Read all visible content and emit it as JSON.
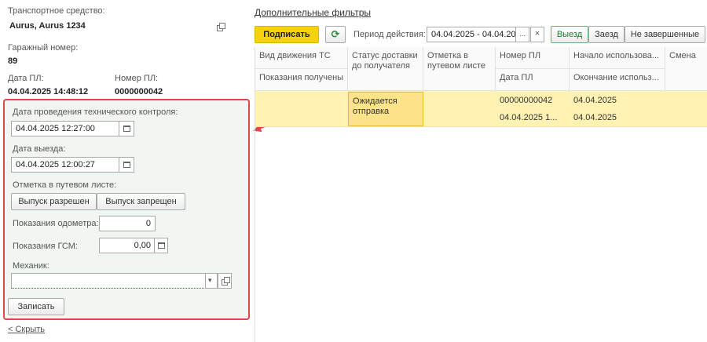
{
  "left": {
    "vehicle_label": "Транспортное средство:",
    "vehicle_value": "Aurus, Aurus 1234",
    "garage_label": "Гаражный номер:",
    "garage_value": "89",
    "date_pl_label": "Дата ПЛ:",
    "date_pl_value": "04.04.2025 14:48:12",
    "number_pl_label": "Номер ПЛ:",
    "number_pl_value": "0000000042"
  },
  "panel": {
    "tech_control_label": "Дата проведения технического контроля:",
    "tech_control_value": "04.04.2025 12:27:00",
    "departure_label": "Дата выезда:",
    "departure_value": "04.04.2025 12:00:27",
    "waybill_mark_label": "Отметка в путевом листе:",
    "allow_button": "Выпуск разрешен",
    "deny_button": "Выпуск запрещен",
    "odometer_label": "Показания одометра:",
    "odometer_value": "0",
    "fuel_label": "Показания ГСМ:",
    "fuel_value": "0,00",
    "mechanic_label": "Механик:",
    "mechanic_value": "",
    "save_button": "Записать"
  },
  "hide_link": "< Скрыть",
  "toolbar": {
    "extra_filters": "Дополнительные фильтры",
    "sign_button": "Подписать",
    "period_label": "Период действия:",
    "period_value": "04.04.2025 - 04.04.20",
    "more_symbol": "...",
    "clear_symbol": "×",
    "filter_departure": "Выезд",
    "filter_arrival": "Заезд",
    "filter_unfinished": "Не завершенные"
  },
  "grid": {
    "headers": {
      "movement_type": "Вид движения ТС",
      "readings_received": "Показания получены",
      "delivery_status": "Статус доставки до получателя",
      "waybill_mark": "Отметка в путевом листе",
      "pl_number": "Номер ПЛ",
      "pl_date": "Дата ПЛ",
      "usage_start": "Начало использова...",
      "usage_end": "Окончание использ...",
      "shift": "Смена"
    },
    "row": {
      "delivery_status": "Ожидается отправка",
      "pl_number": "00000000042",
      "pl_date": "04.04.2025 1...",
      "usage_start": "04.04.2025",
      "usage_end": "04.04.2025"
    }
  },
  "colors": {
    "highlight_border": "#e0464b",
    "panel_bg": "#f2f6f2",
    "selected_row": "#fff2b3",
    "accent_yellow": "#f5d20c"
  }
}
